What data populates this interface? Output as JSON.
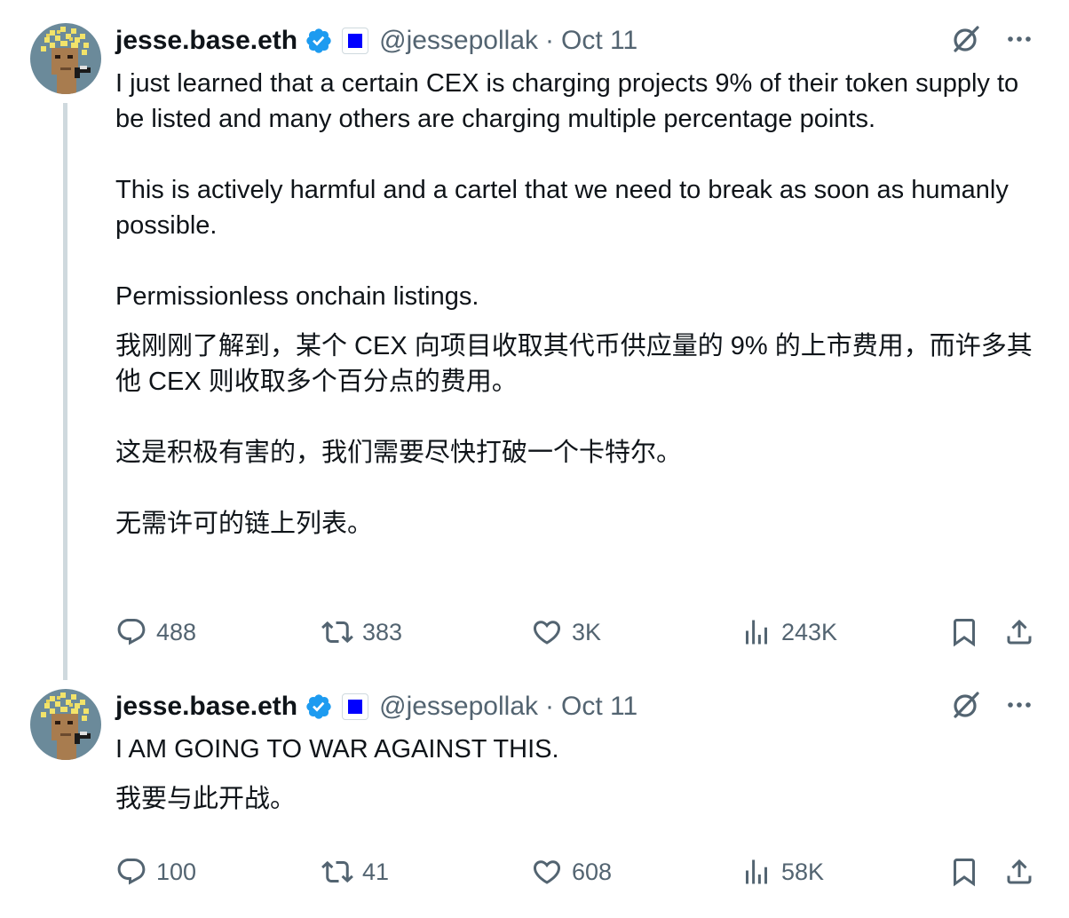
{
  "tweets": [
    {
      "author": {
        "name": "jesse.base.eth",
        "handle": "@jessepollak",
        "separator": "·",
        "date": "Oct 11",
        "avatar_icon": "pixel-art-avatar",
        "verified_icon": "verified-badge-icon",
        "affiliation_icon": "blue-square-affiliate-icon"
      },
      "paragraphs": [
        "I just learned that a certain CEX is charging projects 9% of their token supply to be listed and many others are charging multiple percentage points.\n\nThis is actively harmful and a cartel that we need to break as soon as humanly possible.\n\nPermissionless onchain listings.",
        "我刚刚了解到，某个 CEX 向项目收取其代币供应量的 9% 的上市费用，而许多其他 CEX 则收取多个百分点的费用。\n\n这是积极有害的，我们需要尽快打破一个卡特尔。\n\n无需许可的链上列表。"
      ],
      "stats": {
        "replies": "488",
        "reposts": "383",
        "likes": "3K",
        "views": "243K"
      }
    },
    {
      "author": {
        "name": "jesse.base.eth",
        "handle": "@jessepollak",
        "separator": "·",
        "date": "Oct 11",
        "avatar_icon": "pixel-art-avatar",
        "verified_icon": "verified-badge-icon",
        "affiliation_icon": "blue-square-affiliate-icon"
      },
      "paragraphs": [
        "I AM GOING TO WAR AGAINST THIS.",
        "我要与此开战。"
      ],
      "stats": {
        "replies": "100",
        "reposts": "41",
        "likes": "608",
        "views": "58K"
      }
    }
  ],
  "colors": {
    "text": "#0f1419",
    "secondary": "#536471",
    "verified": "#1d9bf0",
    "affiliate": "#0000ff",
    "thread_line": "#cfd9de"
  }
}
